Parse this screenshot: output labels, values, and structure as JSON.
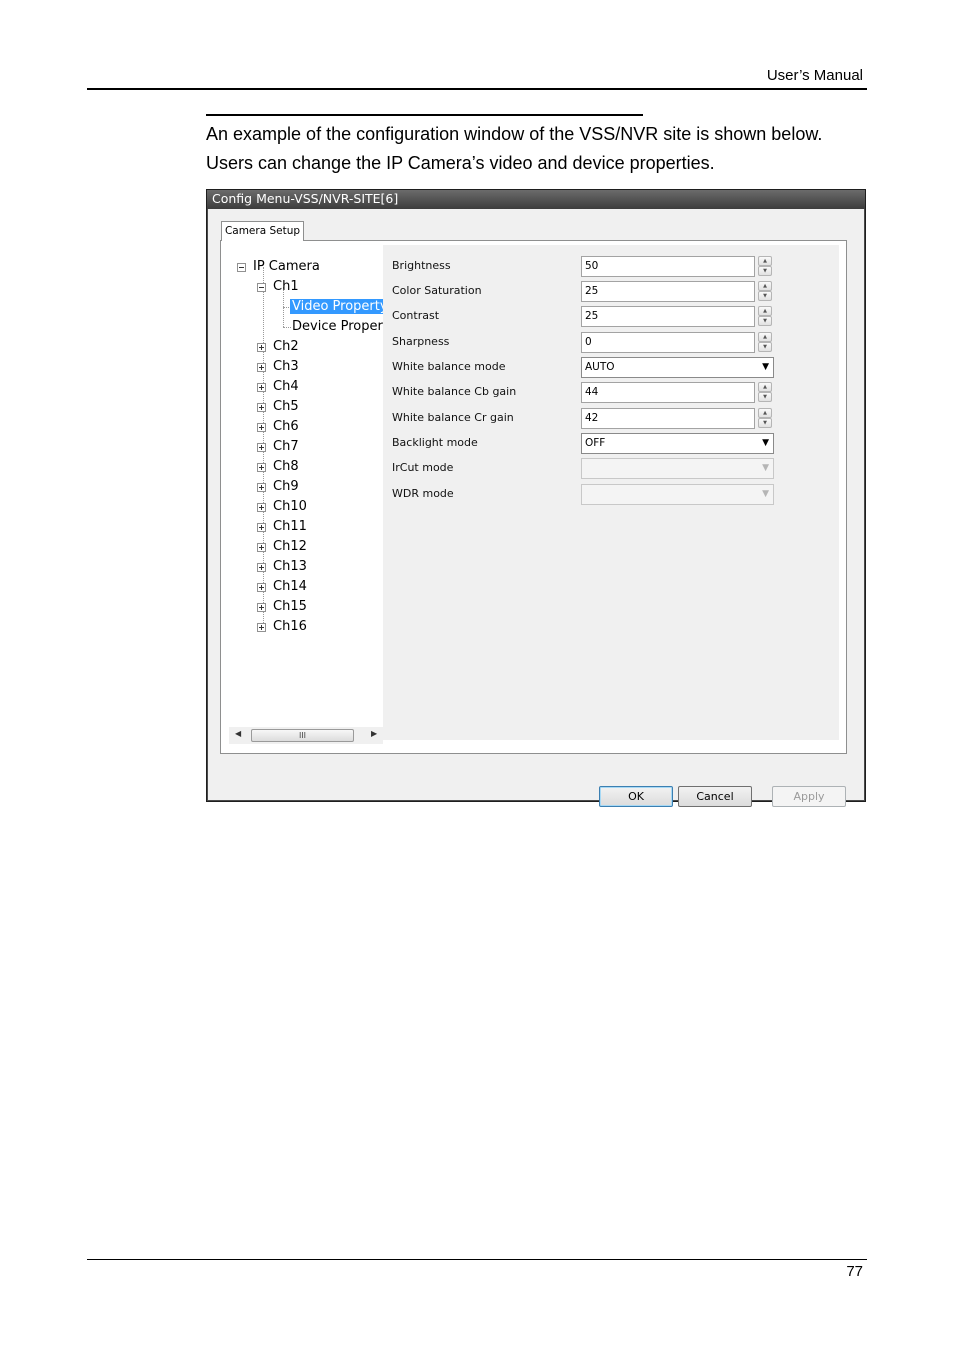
{
  "header": {
    "title": "User’s Manual"
  },
  "intro": {
    "line1": "An example of the configuration window of the VSS/NVR site is shown below.",
    "line2": "Users can change the IP Camera’s video and device properties."
  },
  "window": {
    "title": "Config Menu-VSS/NVR-SITE[6]",
    "tab": "Camera Setup",
    "tree": {
      "root": "IP Camera",
      "ch1": "Ch1",
      "video_property": "Video Property",
      "device_property": "Device Property",
      "channels": [
        "Ch2",
        "Ch3",
        "Ch4",
        "Ch5",
        "Ch6",
        "Ch7",
        "Ch8",
        "Ch9",
        "Ch10",
        "Ch11",
        "Ch12",
        "Ch13",
        "Ch14",
        "Ch15",
        "Ch16"
      ],
      "scroll_thumb": "III"
    },
    "properties": {
      "brightness": {
        "label": "Brightness",
        "value": "50"
      },
      "color_saturation": {
        "label": "Color Saturation",
        "value": "25"
      },
      "contrast": {
        "label": "Contrast",
        "value": "25"
      },
      "sharpness": {
        "label": "Sharpness",
        "value": "0"
      },
      "wb_mode": {
        "label": "White balance mode",
        "value": "AUTO"
      },
      "wb_cb": {
        "label": "White balance Cb gain",
        "value": "44"
      },
      "wb_cr": {
        "label": "White balance Cr gain",
        "value": "42"
      },
      "backlight": {
        "label": "Backlight mode",
        "value": "OFF"
      },
      "ircut": {
        "label": "IrCut mode",
        "value": ""
      },
      "wdr": {
        "label": "WDR mode",
        "value": ""
      }
    },
    "buttons": {
      "ok": "OK",
      "cancel": "Cancel",
      "apply": "Apply"
    }
  },
  "footer": {
    "page": "77"
  }
}
